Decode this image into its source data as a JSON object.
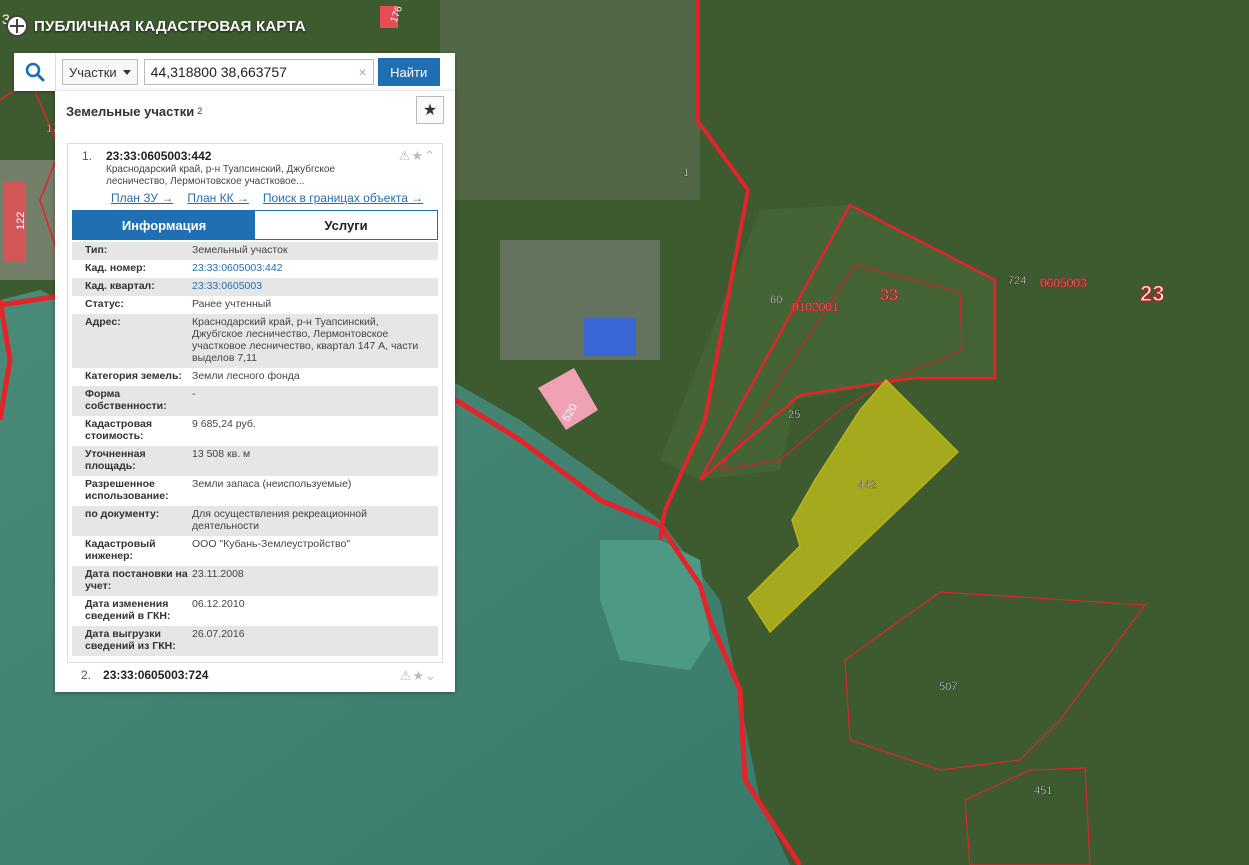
{
  "app": {
    "title": "ПУБЛИЧНАЯ КАДАСТРОВАЯ КАРТА",
    "logo_icon": "globe-cross-icon"
  },
  "search": {
    "type_label": "Участки",
    "query": "44,318800 38,663757",
    "clear_icon": "×",
    "submit_label": "Найти"
  },
  "panel": {
    "title": "Земельные участки",
    "count": "2",
    "items": [
      {
        "num": "1.",
        "id": "23:33:0605003:442",
        "address_short": "Краснодарский край, р-н Туапсинский, Джубгское лесничество, Лермонтовское участковое...",
        "links": [
          "План ЗУ →",
          "План КК →",
          "Поиск в границах объекта →"
        ],
        "tabs": [
          "Информация",
          "Услуги"
        ],
        "rows": [
          {
            "key": "Тип:",
            "val": "Земельный участок",
            "link": false
          },
          {
            "key": "Кад. номер:",
            "val": "23:33:0605003:442",
            "link": true
          },
          {
            "key": "Кад. квартал:",
            "val": "23:33:0605003",
            "link": true
          },
          {
            "key": "Статус:",
            "val": "Ранее учтенный",
            "link": false
          },
          {
            "key": "Адрес:",
            "val": "Краснодарский край, р-н Туапсинский, Джубгское лесничество, Лермонтовское участковое лесничество, квартал 147 А, части выделов 7,11",
            "link": false
          },
          {
            "key": "Категория земель:",
            "val": "Земли лесного фонда",
            "link": false
          },
          {
            "key": "Форма собственности:",
            "val": "-",
            "link": false
          },
          {
            "key": "Кадастровая стоимость:",
            "val": "9 685,24 руб.",
            "link": false
          },
          {
            "key": "Уточненная площадь:",
            "val": "13 508 кв. м",
            "link": false
          },
          {
            "key": "Разрешенное использование:",
            "val": "Земли запаса (неиспользуемые)",
            "link": false
          },
          {
            "key": "по документу:",
            "val": "Для осуществления рекреационной деятельности",
            "link": false
          },
          {
            "key": "Кадастровый инженер:",
            "val": "ООО \"Кубань-Землеустройство\"",
            "link": false
          },
          {
            "key": "Дата постановки на учет:",
            "val": "23.11.2008",
            "link": false
          },
          {
            "key": "Дата изменения сведений в ГКН:",
            "val": "06.12.2010",
            "link": false
          },
          {
            "key": "Дата выгрузки сведений из ГКН:",
            "val": "26.07.2016",
            "link": false
          }
        ]
      },
      {
        "num": "2.",
        "id": "23:33:0605003:724"
      }
    ]
  },
  "map": {
    "labels": [
      "1",
      "724",
      "0605003",
      "23",
      "60",
      "0102001",
      "33",
      "25",
      "442",
      "520",
      "507",
      "451",
      "122",
      "17",
      "176",
      "3"
    ],
    "colors": {
      "sea": "#3f7f6e",
      "land": "#3d5a2e",
      "boundary": "#e4232b",
      "highlight": "#c8c41a"
    }
  }
}
